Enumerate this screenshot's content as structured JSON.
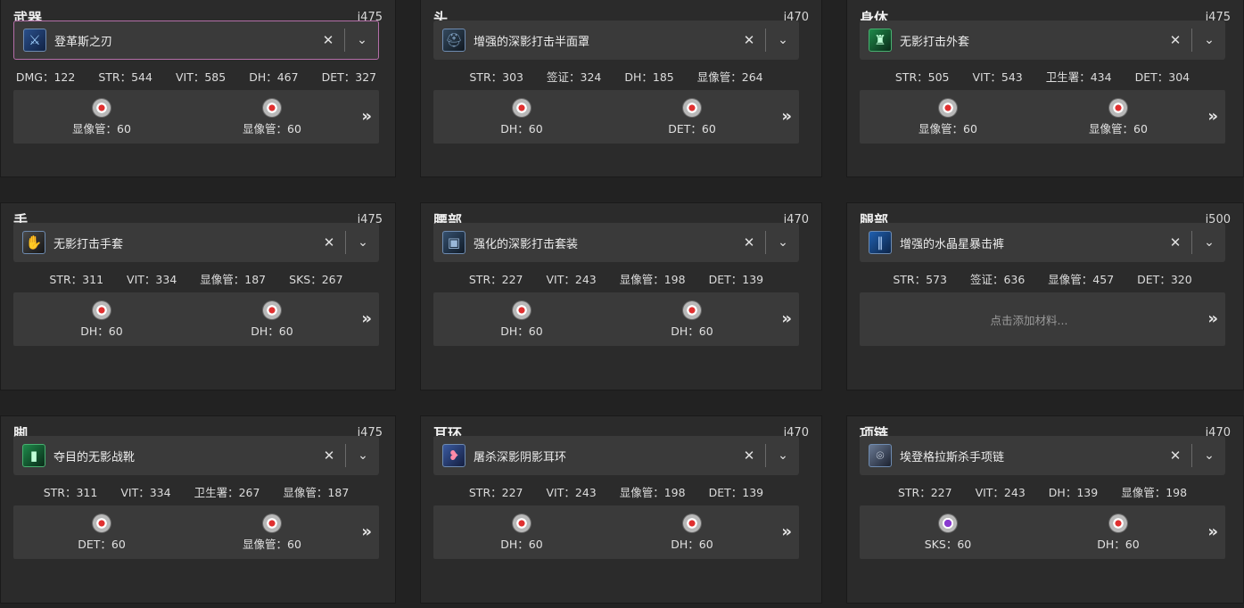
{
  "slots": [
    {
      "slot": "武器",
      "ilvl": "i475",
      "item": "登革斯之刃",
      "icon": "sword-icon",
      "icon_class": "weapon",
      "selected": true,
      "stats": [
        "DMG：122",
        "STR：544",
        "VIT：585",
        "DH：467",
        "DET：327"
      ],
      "materia": [
        {
          "label": "显像管：60",
          "icon": "materia-red-icon"
        },
        {
          "label": "显像管：60",
          "icon": "materia-red-icon"
        }
      ]
    },
    {
      "slot": "头",
      "ilvl": "i470",
      "item": "增强的深影打击半面罩",
      "icon": "helmet-icon",
      "icon_class": "head",
      "stats": [
        "STR：303",
        "签证：324",
        "DH：185",
        "显像管：264"
      ],
      "materia": [
        {
          "label": "DH：60",
          "icon": "materia-red-icon"
        },
        {
          "label": "DET：60",
          "icon": "materia-red-icon"
        }
      ]
    },
    {
      "slot": "身体",
      "ilvl": "i475",
      "item": "无影打击外套",
      "icon": "coat-icon",
      "icon_class": "body",
      "stats": [
        "STR：505",
        "VIT：543",
        "卫生署：434",
        "DET：304"
      ],
      "materia": [
        {
          "label": "显像管：60",
          "icon": "materia-red-icon"
        },
        {
          "label": "显像管：60",
          "icon": "materia-red-icon"
        }
      ]
    },
    {
      "slot": "手",
      "ilvl": "i475",
      "item": "无影打击手套",
      "icon": "gloves-icon",
      "icon_class": "hands",
      "stats": [
        "STR：311",
        "VIT：334",
        "显像管：187",
        "SKS：267"
      ],
      "materia": [
        {
          "label": "DH：60",
          "icon": "materia-red-icon"
        },
        {
          "label": "DH：60",
          "icon": "materia-red-icon"
        }
      ]
    },
    {
      "slot": "腰部",
      "ilvl": "i470",
      "item": "强化的深影打击套装",
      "icon": "belt-icon",
      "icon_class": "waist",
      "stats": [
        "STR：227",
        "VIT：243",
        "显像管：198",
        "DET：139"
      ],
      "materia": [
        {
          "label": "DH：60",
          "icon": "materia-red-icon"
        },
        {
          "label": "DH：60",
          "icon": "materia-red-icon"
        }
      ]
    },
    {
      "slot": "腿部",
      "ilvl": "i500",
      "item": "增强的水晶星暴击裤",
      "icon": "pants-icon",
      "icon_class": "legs",
      "stats": [
        "STR：573",
        "签证：636",
        "显像管：457",
        "DET：320"
      ],
      "materia": [],
      "materia_placeholder": "点击添加材料..."
    },
    {
      "slot": "脚",
      "ilvl": "i475",
      "item": "夺目的无影战靴",
      "icon": "boots-icon",
      "icon_class": "feet",
      "stats": [
        "STR：311",
        "VIT：334",
        "卫生署：267",
        "显像管：187"
      ],
      "materia": [
        {
          "label": "DET：60",
          "icon": "materia-red-icon"
        },
        {
          "label": "显像管：60",
          "icon": "materia-red-icon"
        }
      ]
    },
    {
      "slot": "耳环",
      "ilvl": "i470",
      "item": "屠杀深影阴影耳环",
      "icon": "earring-icon",
      "icon_class": "ear",
      "stats": [
        "STR：227",
        "VIT：243",
        "显像管：198",
        "DET：139"
      ],
      "materia": [
        {
          "label": "DH：60",
          "icon": "materia-red-icon"
        },
        {
          "label": "DH：60",
          "icon": "materia-red-icon"
        }
      ]
    },
    {
      "slot": "项链",
      "ilvl": "i470",
      "item": "埃登格拉斯杀手项链",
      "icon": "necklace-icon",
      "icon_class": "neck",
      "stats": [
        "STR：227",
        "VIT：243",
        "DH：139",
        "显像管：198"
      ],
      "materia": [
        {
          "label": "SKS：60",
          "icon": "materia-purple-icon"
        },
        {
          "label": "DH：60",
          "icon": "materia-red-icon"
        }
      ]
    }
  ],
  "controls": {
    "clear": "✕",
    "dropdown": "⌄",
    "expand": "»"
  }
}
